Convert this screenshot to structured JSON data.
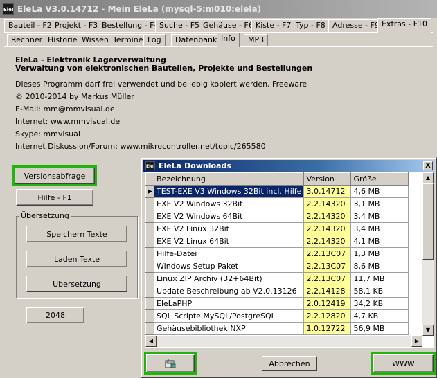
{
  "window": {
    "icon_text": "EleLa",
    "title": "EleLa V3.0.14712 - Mein EleLa (mysql-5:m010:elela)"
  },
  "main_tabs": [
    "Bauteil - F2",
    "Projekt - F3",
    "Bestellung - F4",
    "Suche - F5",
    "Gehäuse - F6",
    "Kiste - F7",
    "Typ - F8",
    "Adresse - F9",
    "Extras - F10"
  ],
  "sub_tabs": [
    "Rechner",
    "Historie",
    "Wissen",
    "Termine",
    "Log",
    "Datenbank",
    "Info",
    "MP3"
  ],
  "info": {
    "heading1": "EleLa - Elektronik Lagerverwaltung",
    "heading2": "Verwaltung von elektronischen Bauteilen, Projekte und Bestellungen",
    "line1": "Dieses Programm darf frei verwendet und beliebig kopiert werden, Freeware",
    "line2": "© 2010-2014 by Markus Müller",
    "line3": "E-Mail: mm@mmvisual.de",
    "line4": "Internet: www.mmvisual.de",
    "line5": "Skype: mmvisual",
    "line6": "Internet Diskussion/Forum: www.mikrocontroller.net/topic/265580"
  },
  "left_buttons": {
    "versionsabfrage": "Versionsabfrage",
    "hilfe": "Hilfe - F1",
    "group_label": "Übersetzung",
    "speichern": "Speichern Texte",
    "laden": "Laden Texte",
    "uebersetzung": "Übersetzung",
    "num": "2048"
  },
  "dialog": {
    "title": "EleLa Downloads",
    "close": "X",
    "columns": [
      "Bezeichnung",
      "Version",
      "Größe"
    ],
    "rows": [
      {
        "name": "TEST-EXE V3 Windows 32Bit incl. Hilfe",
        "version": "3.0.14712",
        "size": "4,6 MB"
      },
      {
        "name": "EXE V2 Windows 32Bit",
        "version": "2.2.14320",
        "size": "3,1 MB"
      },
      {
        "name": "EXE V2 Windows 64Bit",
        "version": "2.2.14320",
        "size": "3,4 MB"
      },
      {
        "name": "EXE V2 Linux 32Bit",
        "version": "2.2.14320",
        "size": "3,4 MB"
      },
      {
        "name": "EXE V2 Linux 64Bit",
        "version": "2.2.14320",
        "size": "4,1 MB"
      },
      {
        "name": "Hilfe-Datei",
        "version": "2.2.13C07",
        "size": "1,3 MB"
      },
      {
        "name": "Windows Setup Paket",
        "version": "2.2.13C07",
        "size": "8,6 MB"
      },
      {
        "name": "Linux ZIP Archiv (32+64Bit)",
        "version": "2.2.13C07",
        "size": "11,7 MB"
      },
      {
        "name": "Update Beschreibung ab V2.0.13126",
        "version": "2.2.14128",
        "size": "58,1 KB"
      },
      {
        "name": "EleLaPHP",
        "version": "2.0.12419",
        "size": "34,2 KB"
      },
      {
        "name": "SQL Scripte MySQL/PostgreSQL",
        "version": "2.2.12820",
        "size": "4,7 KB"
      },
      {
        "name": "Gehäusebibliothek NXP",
        "version": "1.0.12722",
        "size": "56,9 MB"
      }
    ],
    "abbrechen": "Abbrechen",
    "www": "WWW",
    "download_icon": "download-disk-icon"
  },
  "colors": {
    "highlight": "#22b30f",
    "version_cell": "#ffff99",
    "selection": "#0a246a"
  }
}
